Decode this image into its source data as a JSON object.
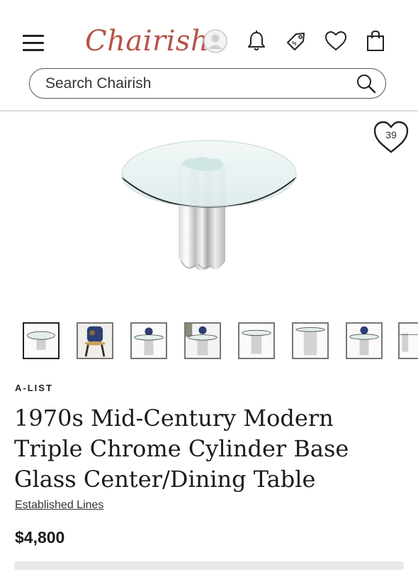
{
  "header": {
    "logo_text": "Chairish",
    "search_placeholder": "Search Chairish"
  },
  "gallery": {
    "favorites_count": "39",
    "thumbnail_count": 8
  },
  "product": {
    "badge": "A-LIST",
    "title": "1970s Mid-Century Modern Triple Chrome Cylinder Base Glass Center/Dining Table",
    "seller": "Established Lines",
    "price": "$4,800"
  },
  "colors": {
    "brand": "#b5544a",
    "text": "#222222"
  }
}
